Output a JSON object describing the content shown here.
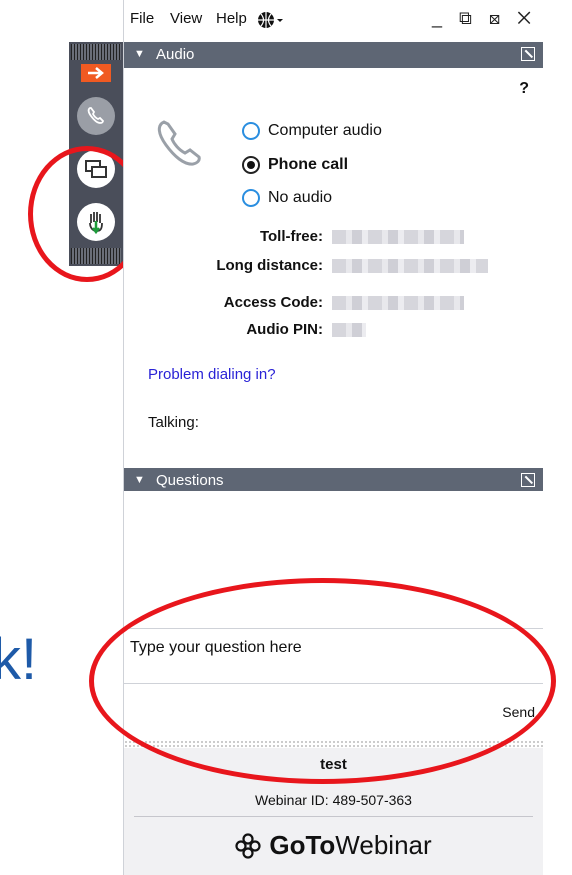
{
  "menu": {
    "file": "File",
    "view": "View",
    "help": "Help"
  },
  "window_controls": "_ ⧉ ⊠ ✕",
  "audio": {
    "header": "Audio",
    "help_mark": "?",
    "options": [
      "Computer audio",
      "Phone call",
      "No audio"
    ],
    "selected": "Phone call",
    "labels": {
      "toll_free": "Toll-free:",
      "long_distance": "Long distance:",
      "access_code": "Access Code:",
      "audio_pin": "Audio PIN:"
    },
    "problem_link": "Problem dialing in?",
    "talking": "Talking:"
  },
  "questions": {
    "header": "Questions",
    "input_placeholder": "Type your question here",
    "send_label": "Send"
  },
  "footer": {
    "title": "test",
    "webinar_id": "Webinar ID: 489-507-363",
    "brand_bold": "GoTo",
    "brand_light": "Webinar"
  },
  "background_text": "k!",
  "colors": {
    "header_bg": "#5e6674",
    "accent_orange": "#f05a22",
    "link_blue": "#2a23d6",
    "annotation_red": "#e8161c"
  },
  "icons": {
    "arrow": "arrow-right-icon",
    "phone": "phone-icon",
    "screen": "screen-share-icon",
    "hand": "raise-hand-icon",
    "globe": "globe-icon"
  }
}
